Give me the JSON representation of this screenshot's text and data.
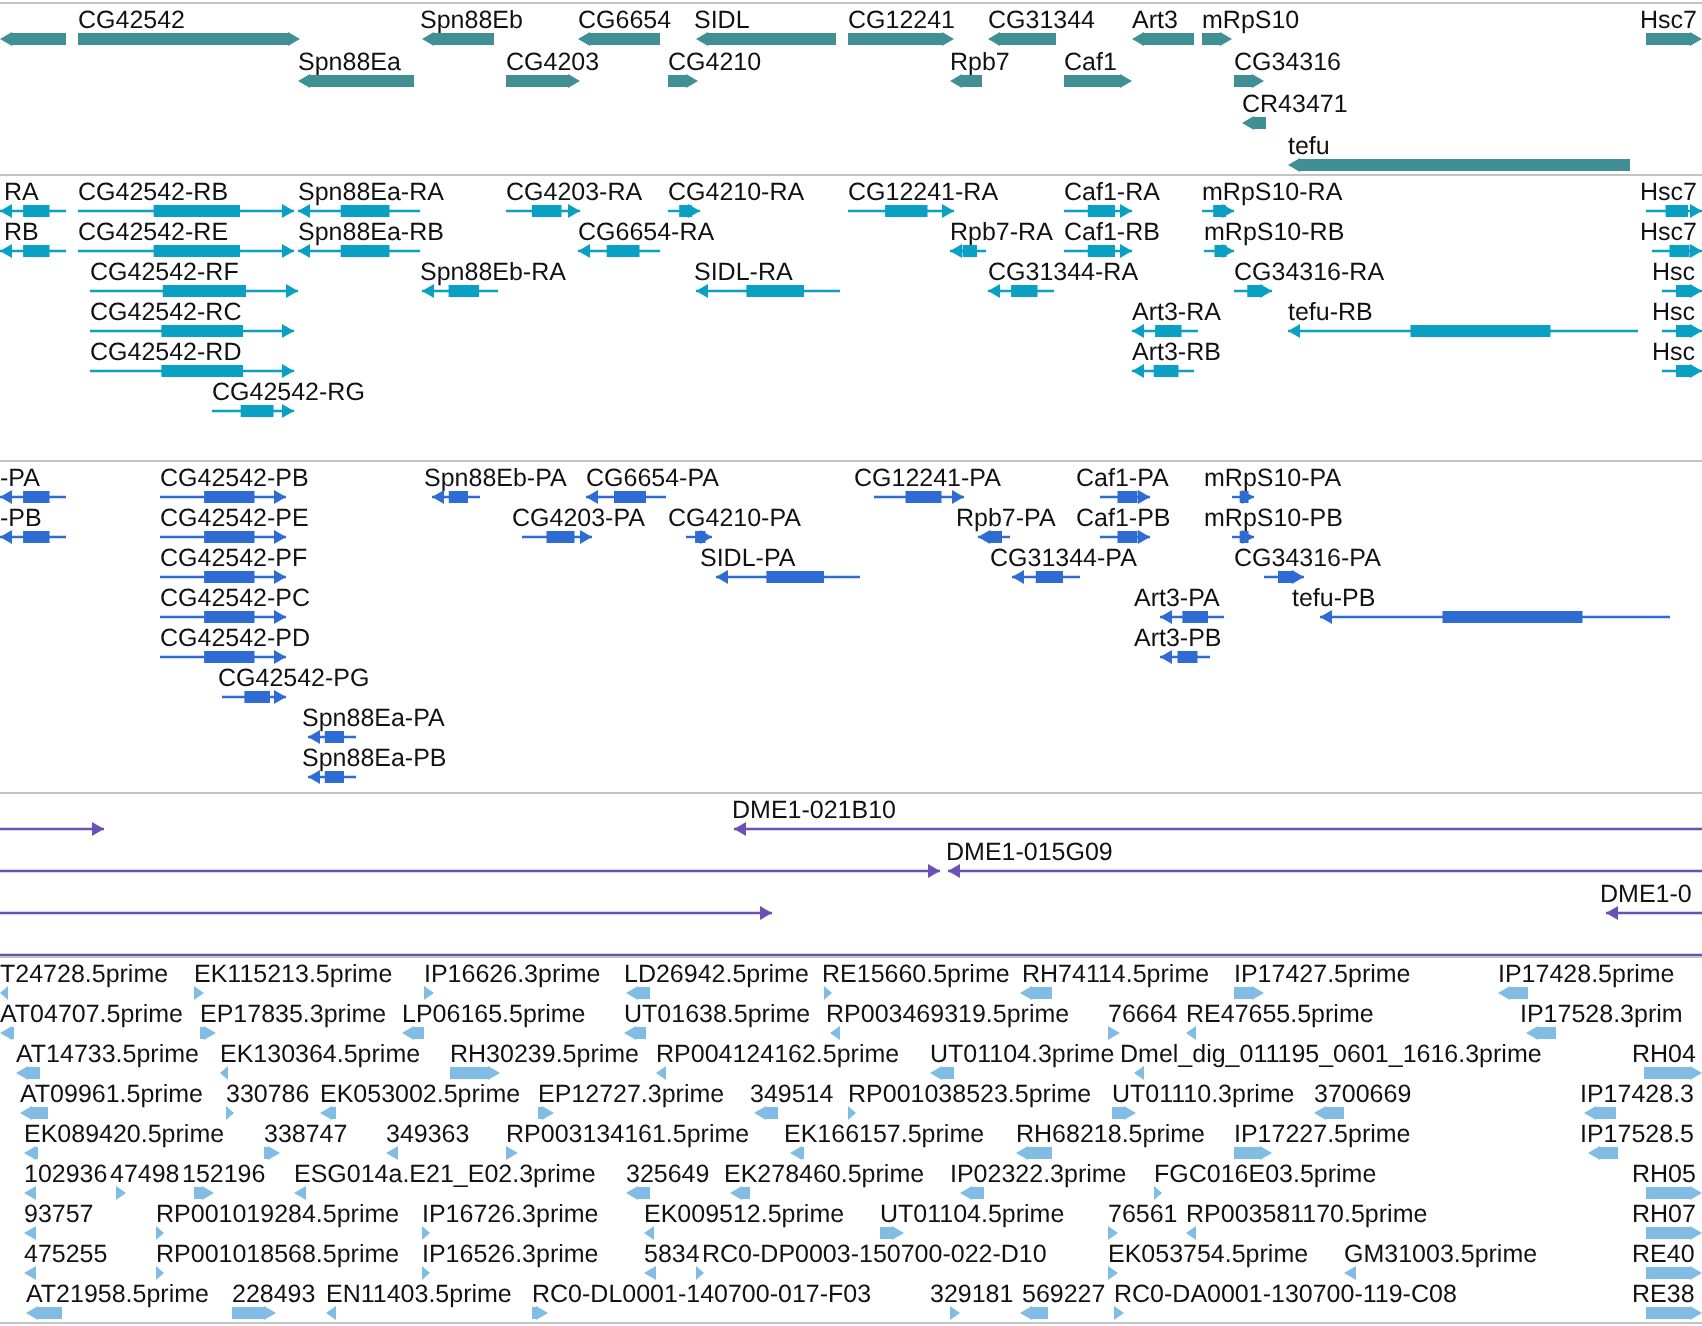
{
  "tracks": [
    {
      "kind": "gene",
      "features": [
        {
          "reverse": true
        },
        {
          "label": "CG42542",
          "reverse": false
        },
        {
          "label": "Spn88Eb",
          "reverse": true
        },
        {
          "label": "CG6654",
          "reverse": true
        },
        {
          "label": "SIDL",
          "reverse": true
        },
        {
          "label": "CG12241",
          "reverse": false
        },
        {
          "label": "CG31344",
          "reverse": true
        },
        {
          "label": "Art3",
          "reverse": true
        },
        {
          "label": "mRpS10",
          "reverse": false
        },
        {
          "label": "Hsc7",
          "reverse": false
        },
        {
          "label": "Spn88Ea",
          "reverse": true
        },
        {
          "label": "CG4203",
          "reverse": false
        },
        {
          "label": "CG4210",
          "reverse": false
        },
        {
          "label": "Rpb7",
          "reverse": true
        },
        {
          "label": "Caf1",
          "reverse": false
        },
        {
          "label": "CG34316",
          "reverse": false
        },
        {
          "label": "CR43471",
          "reverse": true
        },
        {
          "label": "tefu",
          "reverse": true
        }
      ]
    },
    {
      "kind": "transcript",
      "features": [
        {
          "label": "RA",
          "reverse": true
        },
        {
          "label": "CG42542-RB",
          "reverse": false
        },
        {
          "label": "Spn88Ea-RA",
          "reverse": true
        },
        {
          "label": "CG4203-RA",
          "reverse": false
        },
        {
          "label": "CG4210-RA",
          "reverse": false
        },
        {
          "label": "CG12241-RA",
          "reverse": false
        },
        {
          "label": "Caf1-RA",
          "reverse": false
        },
        {
          "label": "mRpS10-RA",
          "reverse": false
        },
        {
          "label": "Hsc7",
          "reverse": false
        },
        {
          "label": "RB",
          "reverse": true
        },
        {
          "label": "CG42542-RE",
          "reverse": false
        },
        {
          "label": "Spn88Ea-RB",
          "reverse": true
        },
        {
          "label": "CG6654-RA",
          "reverse": true
        },
        {
          "label": "Rpb7-RA",
          "reverse": true
        },
        {
          "label": "Caf1-RB",
          "reverse": false
        },
        {
          "label": "mRpS10-RB",
          "reverse": false
        },
        {
          "label": "Hsc7",
          "reverse": false
        },
        {
          "label": "CG42542-RF",
          "reverse": false
        },
        {
          "label": "Spn88Eb-RA",
          "reverse": true
        },
        {
          "label": "SIDL-RA",
          "reverse": true
        },
        {
          "label": "CG31344-RA",
          "reverse": true
        },
        {
          "label": "CG34316-RA",
          "reverse": false
        },
        {
          "label": "Hsc",
          "reverse": false
        },
        {
          "label": "CG42542-RC",
          "reverse": false
        },
        {
          "label": "Art3-RA",
          "reverse": true
        },
        {
          "label": "tefu-RB",
          "reverse": true
        },
        {
          "label": "Hsc",
          "reverse": false
        },
        {
          "label": "CG42542-RD",
          "reverse": false
        },
        {
          "label": "Art3-RB",
          "reverse": true
        },
        {
          "label": "Hsc",
          "reverse": false
        },
        {
          "label": "CG42542-RG",
          "reverse": false
        }
      ]
    },
    {
      "kind": "protein",
      "features": [
        {
          "label": "-PA",
          "reverse": true
        },
        {
          "label": "CG42542-PB",
          "reverse": false
        },
        {
          "label": "Spn88Eb-PA",
          "reverse": true
        },
        {
          "label": "CG6654-PA",
          "reverse": true
        },
        {
          "label": "CG12241-PA",
          "reverse": false
        },
        {
          "label": "Caf1-PA",
          "reverse": false
        },
        {
          "label": "mRpS10-PA",
          "reverse": false
        },
        {
          "label": "-PB",
          "reverse": true
        },
        {
          "label": "CG42542-PE",
          "reverse": false
        },
        {
          "label": "CG4203-PA",
          "reverse": false
        },
        {
          "label": "CG4210-PA",
          "reverse": false
        },
        {
          "label": "Rpb7-PA",
          "reverse": true
        },
        {
          "label": "Caf1-PB",
          "reverse": false
        },
        {
          "label": "mRpS10-PB",
          "reverse": false
        },
        {
          "label": "CG42542-PF",
          "reverse": false
        },
        {
          "label": "SIDL-PA",
          "reverse": true
        },
        {
          "label": "CG31344-PA",
          "reverse": true
        },
        {
          "label": "CG34316-PA",
          "reverse": false
        },
        {
          "label": "CG42542-PC",
          "reverse": false
        },
        {
          "label": "Art3-PA",
          "reverse": true
        },
        {
          "label": "tefu-PB",
          "reverse": true
        },
        {
          "label": "CG42542-PD",
          "reverse": false
        },
        {
          "label": "Art3-PB",
          "reverse": true
        },
        {
          "label": "CG42542-PG",
          "reverse": false
        },
        {
          "label": "Spn88Ea-PA",
          "reverse": true
        },
        {
          "label": "Spn88Ea-PB",
          "reverse": true
        }
      ]
    },
    {
      "kind": "clone",
      "features": [
        {
          "reverse": false,
          "arrow": true
        },
        {
          "label": "DME1-021B10",
          "reverse": true,
          "arrow": true
        },
        {
          "reverse": false,
          "arrow": true
        },
        {
          "label": "DME1-015G09",
          "reverse": true,
          "arrow": true
        },
        {
          "reverse": false,
          "arrow": true
        },
        {
          "label": "DME1-0",
          "reverse": true,
          "arrow": true
        },
        {
          "arrow": false
        }
      ]
    },
    {
      "kind": "est",
      "features": [
        {
          "label": "T24728.5prime",
          "reverse": true
        },
        {
          "label": "EK115213.5prime",
          "reverse": false
        },
        {
          "label": "IP16626.3prime",
          "reverse": false
        },
        {
          "label": "LD26942.5prime",
          "reverse": true
        },
        {
          "label": "RE15660.5prime",
          "reverse": false
        },
        {
          "label": "RH74114.5prime",
          "reverse": true
        },
        {
          "label": "IP17427.5prime",
          "reverse": false
        },
        {
          "label": "IP17428.5prime",
          "reverse": true
        },
        {
          "label": "AT04707.5prime",
          "reverse": true
        },
        {
          "label": "EP17835.3prime",
          "reverse": false
        },
        {
          "label": "LP06165.5prime",
          "reverse": true
        },
        {
          "label": "UT01638.5prime",
          "reverse": true
        },
        {
          "label": "RP003469319.5prime",
          "reverse": true
        },
        {
          "label": "76664",
          "reverse": false
        },
        {
          "label": "RE47655.5prime",
          "reverse": true
        },
        {
          "label": "IP17528.3prim",
          "reverse": true
        },
        {
          "label": "AT14733.5prime",
          "reverse": true
        },
        {
          "label": "EK130364.5prime",
          "reverse": true
        },
        {
          "label": "RH30239.5prime",
          "reverse": false
        },
        {
          "label": "RP004124162.5prime",
          "reverse": true
        },
        {
          "label": "UT01104.3prime",
          "reverse": true
        },
        {
          "label": "Dmel_dig_011195_0601_1616.3prime",
          "reverse": true
        },
        {
          "label": "RH04",
          "reverse": false
        },
        {
          "label": "AT09961.5prime",
          "reverse": true
        },
        {
          "label": "330786",
          "reverse": false
        },
        {
          "label": "EK053002.5prime",
          "reverse": true
        },
        {
          "label": "EP12727.3prime",
          "reverse": false
        },
        {
          "label": "349514",
          "reverse": true
        },
        {
          "label": "RP001038523.5prime",
          "reverse": false
        },
        {
          "label": "UT01110.3prime",
          "reverse": false
        },
        {
          "label": "3700669",
          "reverse": true
        },
        {
          "label": "IP17428.3",
          "reverse": true
        },
        {
          "label": "EK089420.5prime",
          "reverse": true
        },
        {
          "label": "338747",
          "reverse": false
        },
        {
          "label": "349363",
          "reverse": true
        },
        {
          "label": "RP003134161.5prime",
          "reverse": false
        },
        {
          "label": "EK166157.5prime",
          "reverse": true
        },
        {
          "label": "RH68218.5prime",
          "reverse": true
        },
        {
          "label": "IP17227.5prime",
          "reverse": false
        },
        {
          "label": "IP17528.5",
          "reverse": true
        },
        {
          "label": "102936",
          "reverse": true
        },
        {
          "label": "47498",
          "reverse": false
        },
        {
          "label": "152196",
          "reverse": false
        },
        {
          "label": "ESG014a.E21_E02.3prime",
          "reverse": true
        },
        {
          "label": "325649",
          "reverse": true
        },
        {
          "label": "EK278460.5prime",
          "reverse": true
        },
        {
          "label": "IP02322.3prime",
          "reverse": true
        },
        {
          "label": "FGC016E03.5prime",
          "reverse": false
        },
        {
          "label": "RH05",
          "reverse": false
        },
        {
          "label": "93757",
          "reverse": true
        },
        {
          "label": "RP001019284.5prime",
          "reverse": false
        },
        {
          "label": "IP16726.3prime",
          "reverse": false
        },
        {
          "label": "EK009512.5prime",
          "reverse": true
        },
        {
          "label": "UT01104.5prime",
          "reverse": false
        },
        {
          "label": "76561",
          "reverse": false
        },
        {
          "label": "RP003581170.5prime",
          "reverse": true
        },
        {
          "label": "RH07",
          "reverse": false
        },
        {
          "label": "475255",
          "reverse": true
        },
        {
          "label": "RP001018568.5prime",
          "reverse": false
        },
        {
          "label": "IP16526.3prime",
          "reverse": false
        },
        {
          "label": "5834",
          "reverse": true
        },
        {
          "label": "RC0-DP0003-150700-022-D10",
          "reverse": false
        },
        {
          "label": "EK053754.5prime",
          "reverse": false
        },
        {
          "label": "GM31003.5prime",
          "reverse": true
        },
        {
          "label": "RE40",
          "reverse": false
        },
        {
          "label": "AT21958.5prime",
          "reverse": true
        },
        {
          "label": "228493",
          "reverse": false
        },
        {
          "label": "EN11403.5prime",
          "reverse": true
        },
        {
          "label": "RC0-DL0001-140700-017-F03",
          "reverse": false
        },
        {
          "label": "329181",
          "reverse": false
        },
        {
          "label": "569227",
          "reverse": true
        },
        {
          "label": "RC0-DA0001-130700-119-C08",
          "reverse": false
        },
        {
          "label": "RE38",
          "reverse": false
        }
      ]
    }
  ]
}
